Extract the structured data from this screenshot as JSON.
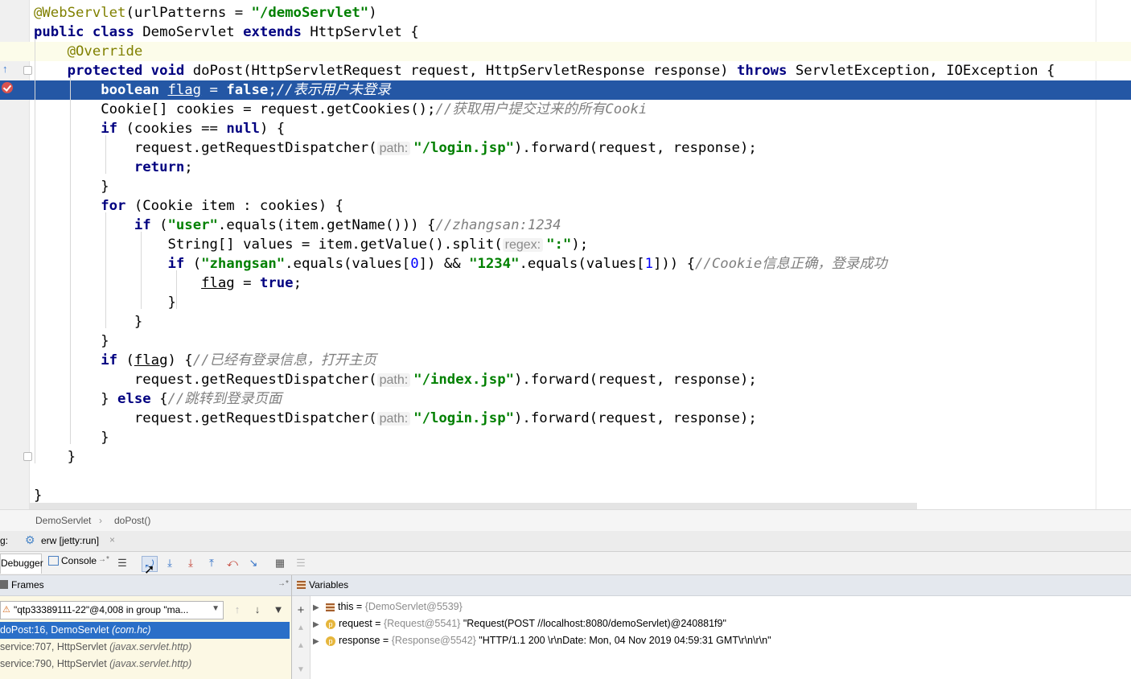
{
  "editor": {
    "lines": [
      {
        "row": 0,
        "segments": [
          [
            "ann",
            "@WebServlet"
          ],
          [
            "p",
            "(urlPatterns = "
          ],
          [
            "str",
            "\"/demoServlet\""
          ],
          [
            "p",
            ")"
          ]
        ]
      },
      {
        "row": 1,
        "segments": [
          [
            "kw",
            "public class "
          ],
          [
            "p",
            "DemoServlet "
          ],
          [
            "kw",
            "extends "
          ],
          [
            "p",
            "HttpServlet {"
          ]
        ]
      },
      {
        "row": 2,
        "segments": [
          [
            "p",
            "    "
          ],
          [
            "ann",
            "@Override"
          ]
        ]
      },
      {
        "row": 3,
        "segments": [
          [
            "p",
            "    "
          ],
          [
            "kw",
            "protected void "
          ],
          [
            "p",
            "doPost(HttpServletRequest request, HttpServletResponse response) "
          ],
          [
            "kw",
            "throws "
          ],
          [
            "p",
            "ServletException, IOException {"
          ]
        ]
      },
      {
        "row": 4,
        "segments": [
          [
            "p",
            "        "
          ],
          [
            "kw",
            "boolean "
          ],
          [
            "u",
            "flag"
          ],
          [
            "p",
            " = "
          ],
          [
            "kw",
            "false"
          ],
          [
            "p",
            ";"
          ],
          [
            "cmt",
            "//表示用户未登录"
          ]
        ]
      },
      {
        "row": 5,
        "segments": [
          [
            "p",
            "        Cookie[] cookies = request.getCookies();"
          ],
          [
            "cmt",
            "//获取用户提交过来的所有Cooki"
          ]
        ]
      },
      {
        "row": 6,
        "segments": [
          [
            "p",
            "        "
          ],
          [
            "kw",
            "if "
          ],
          [
            "p",
            "(cookies == "
          ],
          [
            "kw",
            "null"
          ],
          [
            "p",
            ") {"
          ]
        ]
      },
      {
        "row": 7,
        "segments": [
          [
            "p",
            "            request.getRequestDispatcher("
          ],
          [
            "hint",
            "path:"
          ],
          [
            "str",
            "\"/login.jsp\""
          ],
          [
            "p",
            ").forward(request, response);"
          ]
        ]
      },
      {
        "row": 8,
        "segments": [
          [
            "p",
            "            "
          ],
          [
            "kw",
            "return"
          ],
          [
            "p",
            ";"
          ]
        ]
      },
      {
        "row": 9,
        "segments": [
          [
            "p",
            "        }"
          ]
        ]
      },
      {
        "row": 10,
        "segments": [
          [
            "p",
            "        "
          ],
          [
            "kw",
            "for "
          ],
          [
            "p",
            "(Cookie item : cookies) {"
          ]
        ]
      },
      {
        "row": 11,
        "segments": [
          [
            "p",
            "            "
          ],
          [
            "kw",
            "if "
          ],
          [
            "p",
            "("
          ],
          [
            "str",
            "\"user\""
          ],
          [
            "p",
            ".equals(item.getName())) {"
          ],
          [
            "cmt",
            "//zhangsan:1234"
          ]
        ]
      },
      {
        "row": 12,
        "segments": [
          [
            "p",
            "                String[] values = item.getValue().split("
          ],
          [
            "hint",
            "regex:"
          ],
          [
            "str",
            "\":\""
          ],
          [
            "p",
            ");"
          ]
        ]
      },
      {
        "row": 13,
        "segments": [
          [
            "p",
            "                "
          ],
          [
            "kw",
            "if "
          ],
          [
            "p",
            "("
          ],
          [
            "str",
            "\"zhangsan\""
          ],
          [
            "p",
            ".equals(values["
          ],
          [
            "num",
            "0"
          ],
          [
            "p",
            "]) && "
          ],
          [
            "str",
            "\"1234\""
          ],
          [
            "p",
            ".equals(values["
          ],
          [
            "num",
            "1"
          ],
          [
            "p",
            "])) {"
          ],
          [
            "cmt",
            "//Cookie信息正确，登录成功"
          ]
        ]
      },
      {
        "row": 14,
        "segments": [
          [
            "p",
            "                    "
          ],
          [
            "u",
            "flag"
          ],
          [
            "p",
            " = "
          ],
          [
            "kw",
            "true"
          ],
          [
            "p",
            ";"
          ]
        ]
      },
      {
        "row": 15,
        "segments": [
          [
            "p",
            "                }"
          ]
        ]
      },
      {
        "row": 16,
        "segments": [
          [
            "p",
            "            }"
          ]
        ]
      },
      {
        "row": 17,
        "segments": [
          [
            "p",
            "        }"
          ]
        ]
      },
      {
        "row": 18,
        "segments": [
          [
            "p",
            "        "
          ],
          [
            "kw",
            "if "
          ],
          [
            "p",
            "("
          ],
          [
            "u",
            "flag"
          ],
          [
            "p",
            ") {"
          ],
          [
            "cmt",
            "//已经有登录信息，打开主页"
          ]
        ]
      },
      {
        "row": 19,
        "segments": [
          [
            "p",
            "            request.getRequestDispatcher("
          ],
          [
            "hint",
            "path:"
          ],
          [
            "str",
            "\"/index.jsp\""
          ],
          [
            "p",
            ").forward(request, response);"
          ]
        ]
      },
      {
        "row": 20,
        "segments": [
          [
            "p",
            "        } "
          ],
          [
            "kw",
            "else "
          ],
          [
            "p",
            "{"
          ],
          [
            "cmt",
            "//跳转到登录页面"
          ]
        ]
      },
      {
        "row": 21,
        "segments": [
          [
            "p",
            "            request.getRequestDispatcher("
          ],
          [
            "hint",
            "path:"
          ],
          [
            "str",
            "\"/login.jsp\""
          ],
          [
            "p",
            ").forward(request, response);"
          ]
        ]
      },
      {
        "row": 22,
        "segments": [
          [
            "p",
            "        }"
          ]
        ]
      },
      {
        "row": 23,
        "segments": [
          [
            "p",
            "    }"
          ]
        ]
      },
      {
        "row": 24,
        "segments": [
          [
            "p",
            ""
          ]
        ]
      },
      {
        "row": 25,
        "segments": [
          [
            "p",
            "}"
          ]
        ]
      }
    ],
    "highlighted_rows": [
      2
    ],
    "current_row": 4
  },
  "breadcrumb": {
    "class_name": "DemoServlet",
    "method_name": "doPost()",
    "separator": "›"
  },
  "runbar": {
    "prefix": "g:",
    "config_label": "erw [jetty:run]",
    "close_glyph": "×"
  },
  "toolbar": {
    "debugger_tab": "Debugger",
    "console_tab": "Console",
    "console_arrow": "→*"
  },
  "frames": {
    "title": "Frames",
    "pin_glyph": "→*",
    "thread": "\"qtp33389111-22\"@4,008 in group \"ma...",
    "rows": [
      {
        "method": "doPost:16, DemoServlet ",
        "pkg": "(com.hc)",
        "selected": true
      },
      {
        "method": "service:707, HttpServlet ",
        "pkg": "(javax.servlet.http)",
        "selected": false
      },
      {
        "method": "service:790, HttpServlet ",
        "pkg": "(javax.servlet.http)",
        "selected": false
      }
    ]
  },
  "variables": {
    "title": "Variables",
    "rows": [
      {
        "name": "this",
        "eq": " = ",
        "ref": "{DemoServlet@5539}",
        "value": "",
        "badge": "fields"
      },
      {
        "name": "request",
        "eq": " = ",
        "ref": "{Request@5541} ",
        "value": "\"Request(POST //localhost:8080/demoServlet)@240881f9\"",
        "badge": "p"
      },
      {
        "name": "response",
        "eq": " = ",
        "ref": "{Response@5542} ",
        "value": "\"HTTP/1.1 200 \\r\\nDate: Mon, 04 Nov 2019 04:59:31 GMT\\r\\n\\r\\n\"",
        "badge": "p"
      }
    ]
  }
}
